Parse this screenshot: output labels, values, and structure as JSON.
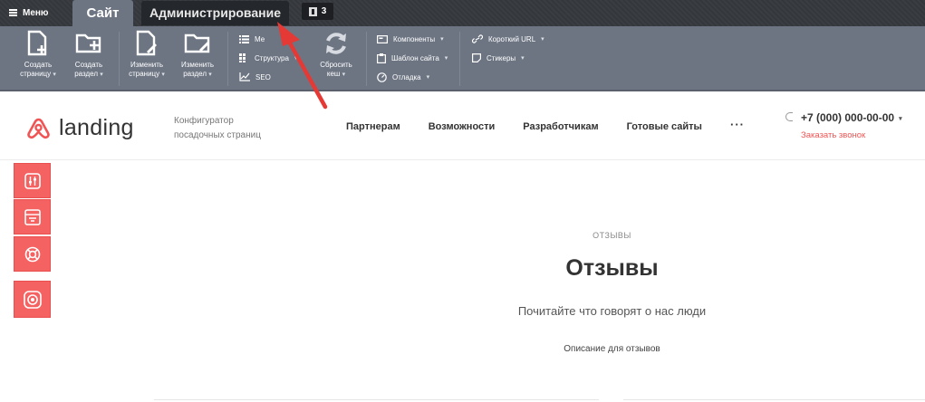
{
  "topbar": {
    "menu_label": "Меню",
    "tab_site": "Сайт",
    "tab_admin": "Администрирование",
    "notifications_count": "3"
  },
  "toolbar": {
    "create_page": [
      "Создать",
      "страницу"
    ],
    "create_section": [
      "Создать",
      "раздел"
    ],
    "edit_page": [
      "Изменить",
      "страницу"
    ],
    "edit_section": [
      "Изменить",
      "раздел"
    ],
    "menu_item": "Ме",
    "structure_item": "Структура",
    "seo_item": "SEO",
    "reset_cache": [
      "Сбросить",
      "кеш"
    ],
    "components": "Компоненты",
    "site_template": "Шаблон сайта",
    "debug": "Отладка",
    "short_url": "Короткий URL",
    "stickers": "Стикеры"
  },
  "header": {
    "logo_text": "landing",
    "tagline_line1": "Конфигуратор",
    "tagline_line2": "посадочных страниц",
    "nav": [
      "Партнерам",
      "Возможности",
      "Разработчикам",
      "Готовые сайты"
    ],
    "nav_more": "···",
    "phone": "+7 (000) 000-00-00",
    "callback": "Заказать звонок"
  },
  "content": {
    "label": "ОТЗЫВЫ",
    "title": "Отзывы",
    "subtitle": "Почитайте что говорят о нас люди",
    "description": "Описание для отзывов"
  },
  "colors": {
    "accent": "#f56262",
    "admin_panel": "#6d7583",
    "admin_bar": "#3a3d42",
    "annotation_arrow": "#e53935"
  }
}
